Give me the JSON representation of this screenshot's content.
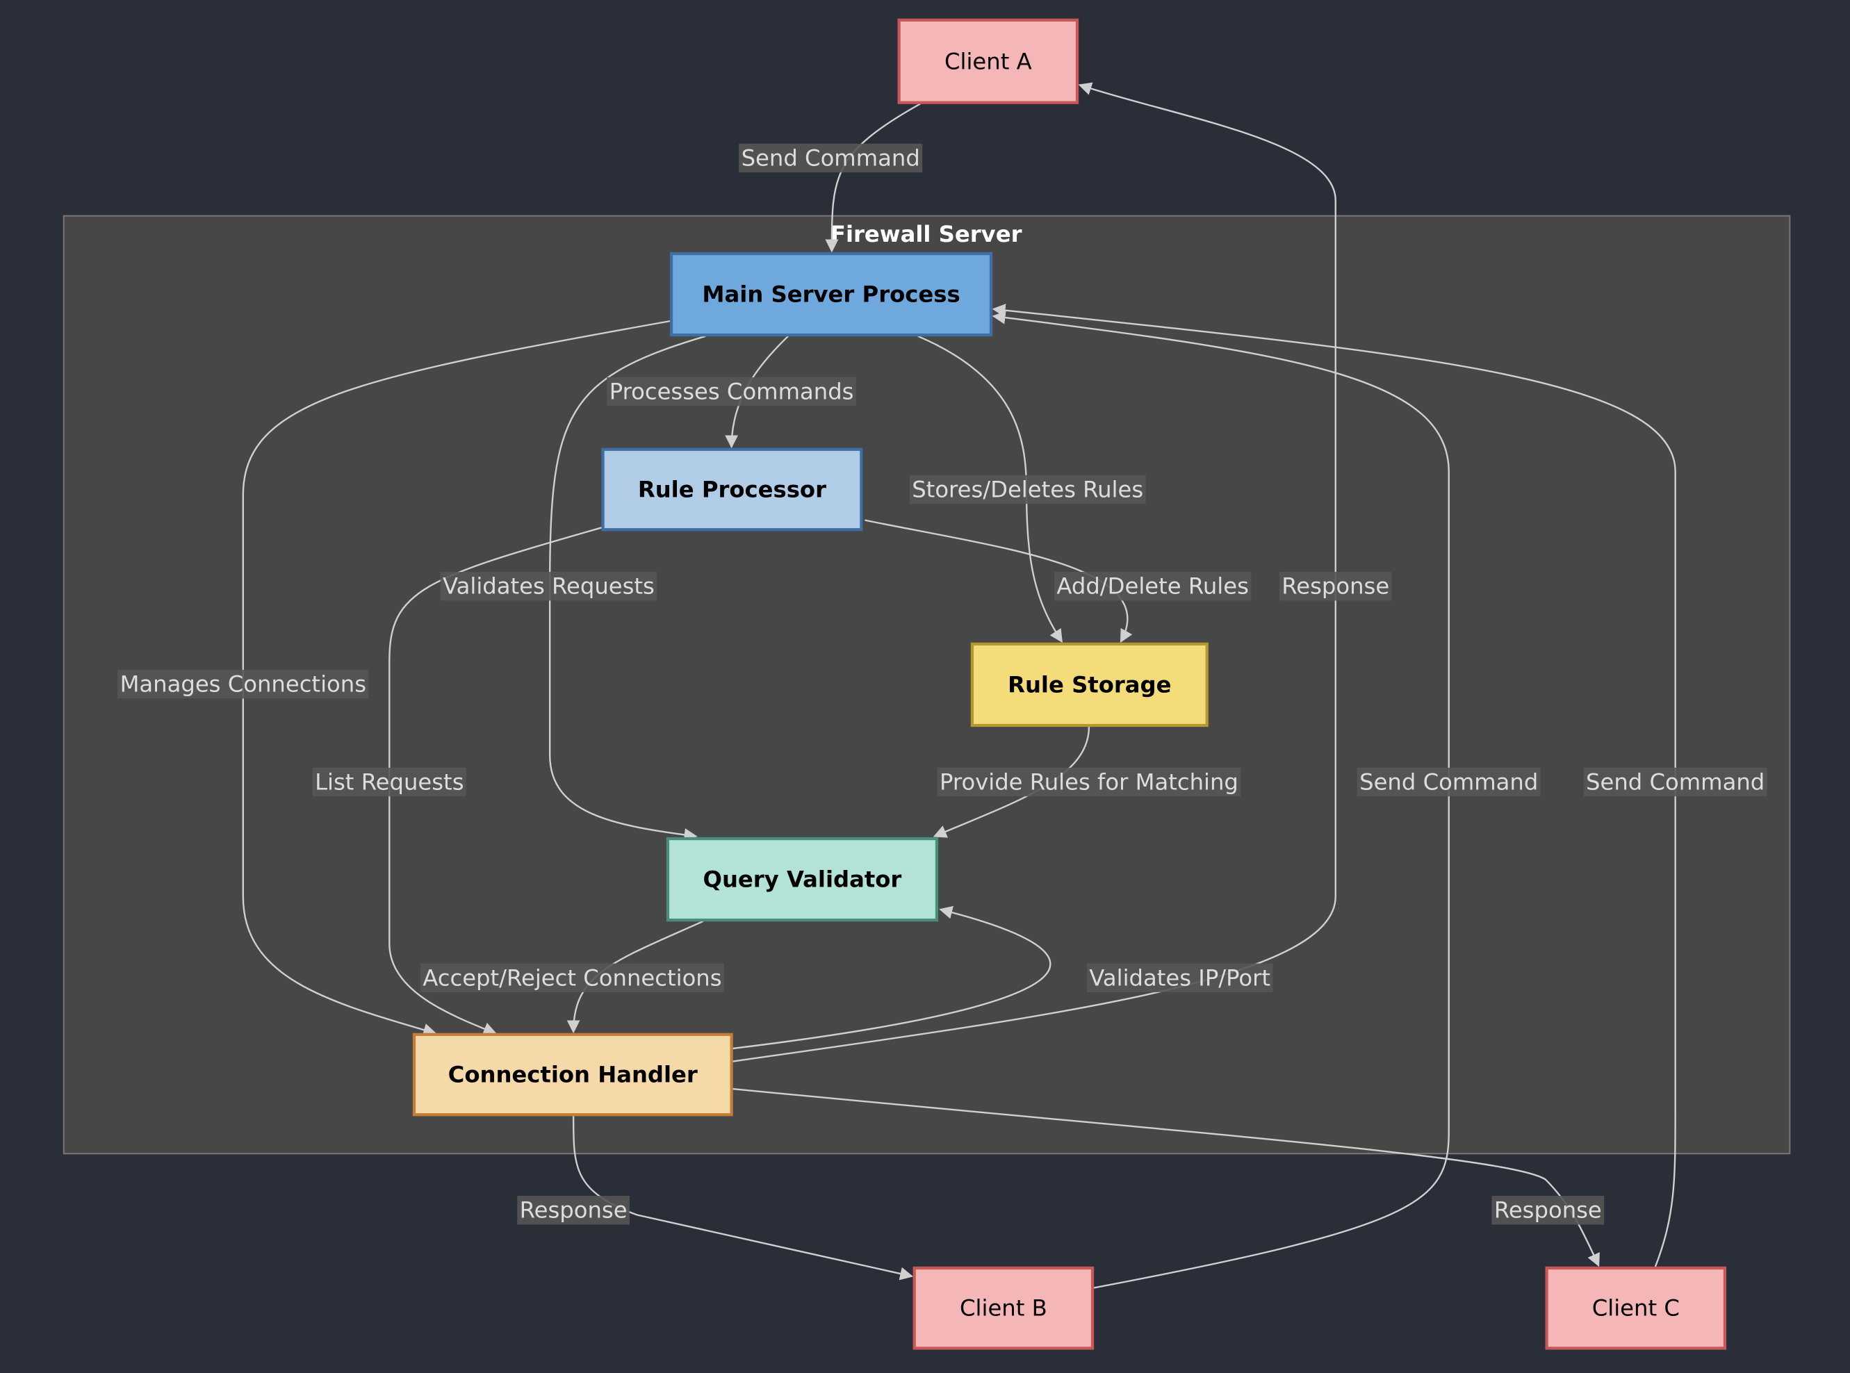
{
  "diagram": {
    "background": "#2a2e39",
    "cluster": {
      "title": "Firewall Server",
      "fill": "#474747",
      "stroke": "#777777"
    },
    "nodes": {
      "clientA": {
        "label": "Client A",
        "fill": "#f4b6b6",
        "stroke": "#c85858"
      },
      "main": {
        "label": "Main Server Process",
        "fill": "#6fa8dc",
        "stroke": "#3d6fa5"
      },
      "ruleProc": {
        "label": "Rule Processor",
        "fill": "#b0cce6",
        "stroke": "#3d6fa5"
      },
      "ruleStore": {
        "label": "Rule Storage",
        "fill": "#f5dc7a",
        "stroke": "#b39a30"
      },
      "validator": {
        "label": "Query Validator",
        "fill": "#b2e3d6",
        "stroke": "#4a8d78"
      },
      "conn": {
        "label": "Connection Handler",
        "fill": "#f6d9a8",
        "stroke": "#c47d35"
      },
      "clientB": {
        "label": "Client B",
        "fill": "#f4b6b6",
        "stroke": "#c85858"
      },
      "clientC": {
        "label": "Client C",
        "fill": "#f4b6b6",
        "stroke": "#c85858"
      }
    },
    "edges": [
      {
        "from": "clientA",
        "to": "main",
        "label": "Send Command"
      },
      {
        "from": "main",
        "to": "ruleProc",
        "label": "Processes Commands"
      },
      {
        "from": "main",
        "to": "ruleStore",
        "label": "Stores/Deletes Rules"
      },
      {
        "from": "main",
        "to": "validator",
        "label": "Validates Requests"
      },
      {
        "from": "main",
        "to": "conn",
        "label": "Manages Connections"
      },
      {
        "from": "ruleProc",
        "to": "ruleStore",
        "label": "Add/Delete Rules"
      },
      {
        "from": "ruleProc",
        "to": "conn",
        "label": "List Requests"
      },
      {
        "from": "ruleStore",
        "to": "validator",
        "label": "Provide Rules for Matching"
      },
      {
        "from": "validator",
        "to": "conn",
        "label": "Accept/Reject Connections"
      },
      {
        "from": "conn",
        "to": "validator",
        "label": "Validates IP/Port"
      },
      {
        "from": "conn",
        "to": "clientA",
        "label": "Response"
      },
      {
        "from": "conn",
        "to": "clientB",
        "label": "Response"
      },
      {
        "from": "conn",
        "to": "clientC",
        "label": "Response"
      },
      {
        "from": "clientB",
        "to": "main",
        "label": "Send Command"
      },
      {
        "from": "clientC",
        "to": "main",
        "label": "Send Command"
      }
    ]
  }
}
